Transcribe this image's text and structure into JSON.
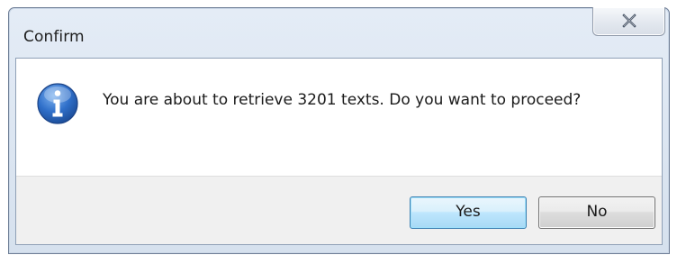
{
  "window": {
    "title": "Confirm"
  },
  "dialog": {
    "icon": "info-icon",
    "message": "You are about to retrieve 3201 texts. Do you want to proceed?"
  },
  "buttons": {
    "yes_label": "Yes",
    "no_label": "No"
  },
  "colors": {
    "default_button_border": "#3c7fb1",
    "info_icon_blue": "#2a63b8",
    "button_bar_background": "#f0f0f0"
  }
}
